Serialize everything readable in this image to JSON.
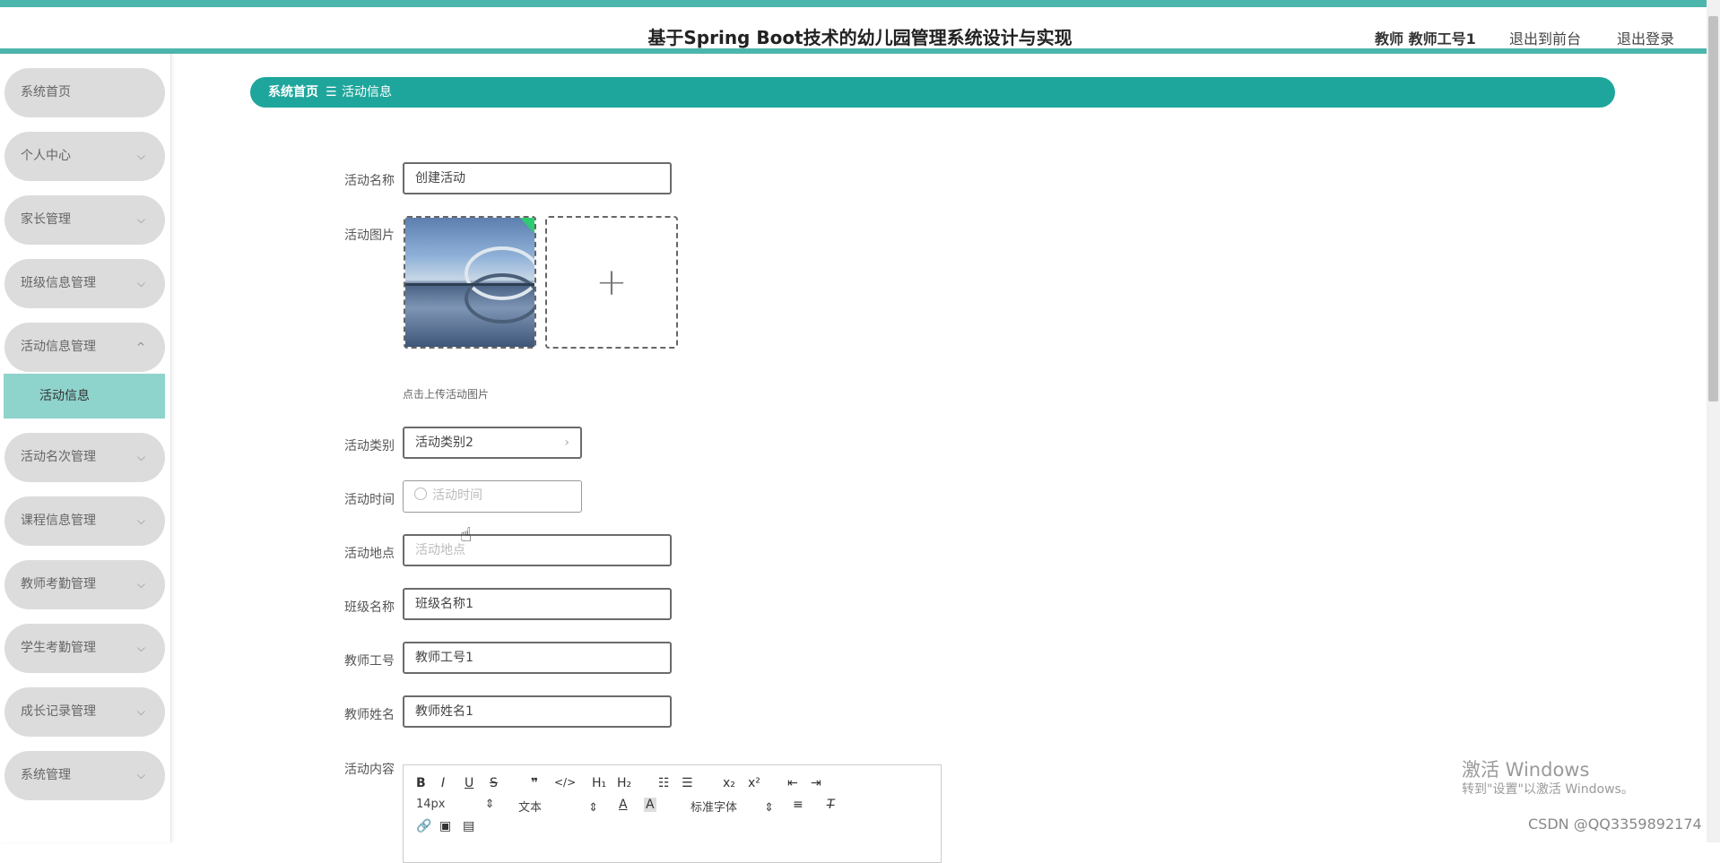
{
  "header": {
    "title": "基于Spring Boot技术的幼儿园管理系统设计与实现",
    "user": "教师 教师工号1",
    "front_link": "退出到前台",
    "logout_link": "退出登录"
  },
  "sidebar": {
    "items": [
      {
        "label": "系统首页"
      },
      {
        "label": "个人中心"
      },
      {
        "label": "家长管理"
      },
      {
        "label": "班级信息管理"
      },
      {
        "label": "活动信息管理"
      },
      {
        "label": "活动名次管理"
      },
      {
        "label": "课程信息管理"
      },
      {
        "label": "教师考勤管理"
      },
      {
        "label": "学生考勤管理"
      },
      {
        "label": "成长记录管理"
      },
      {
        "label": "系统管理"
      }
    ],
    "submenu": {
      "label": "活动信息"
    }
  },
  "breadcrumb": {
    "home": "系统首页",
    "separator": "☰",
    "current": "活动信息"
  },
  "form": {
    "name_label": "活动名称",
    "name_value": "创建活动",
    "image_label": "活动图片",
    "image_hint": "点击上传活动图片",
    "category_label": "活动类别",
    "category_value": "活动类别2",
    "time_label": "活动时间",
    "time_placeholder": "活动时间",
    "location_label": "活动地点",
    "location_placeholder": "活动地点",
    "class_label": "班级名称",
    "class_value": "班级名称1",
    "teacher_id_label": "教师工号",
    "teacher_id_value": "教师工号1",
    "teacher_name_label": "教师姓名",
    "teacher_name_value": "教师姓名1",
    "content_label": "活动内容"
  },
  "editor": {
    "font_size": "14px",
    "block_type": "文本",
    "font_family": "标准字体"
  },
  "watermark": {
    "line1": "激活 Windows",
    "line2": "转到\"设置\"以激活 Windows。",
    "csdn": "CSDN @QQ3359892174"
  },
  "colors": {
    "accent": "#1fa69c",
    "accent_light": "#8fd3cd",
    "menu_bg": "#dcdcdc"
  }
}
